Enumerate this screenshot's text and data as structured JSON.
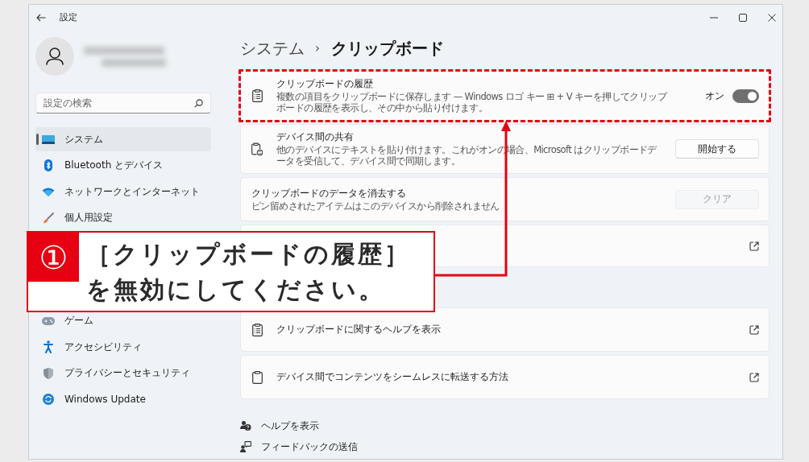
{
  "window": {
    "title": "設定"
  },
  "search": {
    "placeholder": "設定の検索"
  },
  "sidebar": {
    "items": [
      {
        "label": "システム",
        "selected": true
      },
      {
        "label": "Bluetooth とデバイス",
        "selected": false
      },
      {
        "label": "ネットワークとインターネット",
        "selected": false
      },
      {
        "label": "個人用設定",
        "selected": false
      }
    ],
    "lower_items": [
      {
        "label": "ゲーム",
        "selected": false
      },
      {
        "label": "アクセシビリティ",
        "selected": false
      },
      {
        "label": "プライバシーとセキュリティ",
        "selected": false
      },
      {
        "label": "Windows Update",
        "selected": false
      }
    ]
  },
  "breadcrumb": {
    "parent": "システム",
    "separator": "›",
    "current": "クリップボード"
  },
  "cards": [
    {
      "kind": "toggle",
      "title": "クリップボードの履歴",
      "description": "複数の項目をクリップボードに保存します — Windows ロゴ キー ⊞ + V キーを押してクリップボードの履歴を表示し、その中から貼り付けます。",
      "state_label": "オン",
      "on": true,
      "highlighted": true
    },
    {
      "kind": "button",
      "title": "デバイス間の共有",
      "description": "他のデバイスにテキストを貼り付けます。これがオンの場合、Microsoft はクリップボードデータを受信して、デバイス間で同期します。",
      "button": "開始する",
      "disabled": false,
      "highlighted": false
    },
    {
      "kind": "button",
      "title": "クリップボードのデータを消去する",
      "description": "ピン留めされたアイテムはこのデバイスから削除されません",
      "button": "クリア",
      "disabled": true,
      "highlighted": false
    },
    {
      "kind": "link",
      "highlighted": false
    }
  ],
  "related_links": [
    {
      "title": "クリップボードに関するヘルプを表示"
    },
    {
      "title": "デバイス間でコンテンツをシームレスに転送する方法"
    }
  ],
  "footer_links": [
    {
      "label": "ヘルプを表示"
    },
    {
      "label": "フィードバックの送信"
    }
  ],
  "callout": {
    "number": "①",
    "lines": [
      "［クリップボードの履歴］",
      "を無効にしてください。"
    ]
  }
}
